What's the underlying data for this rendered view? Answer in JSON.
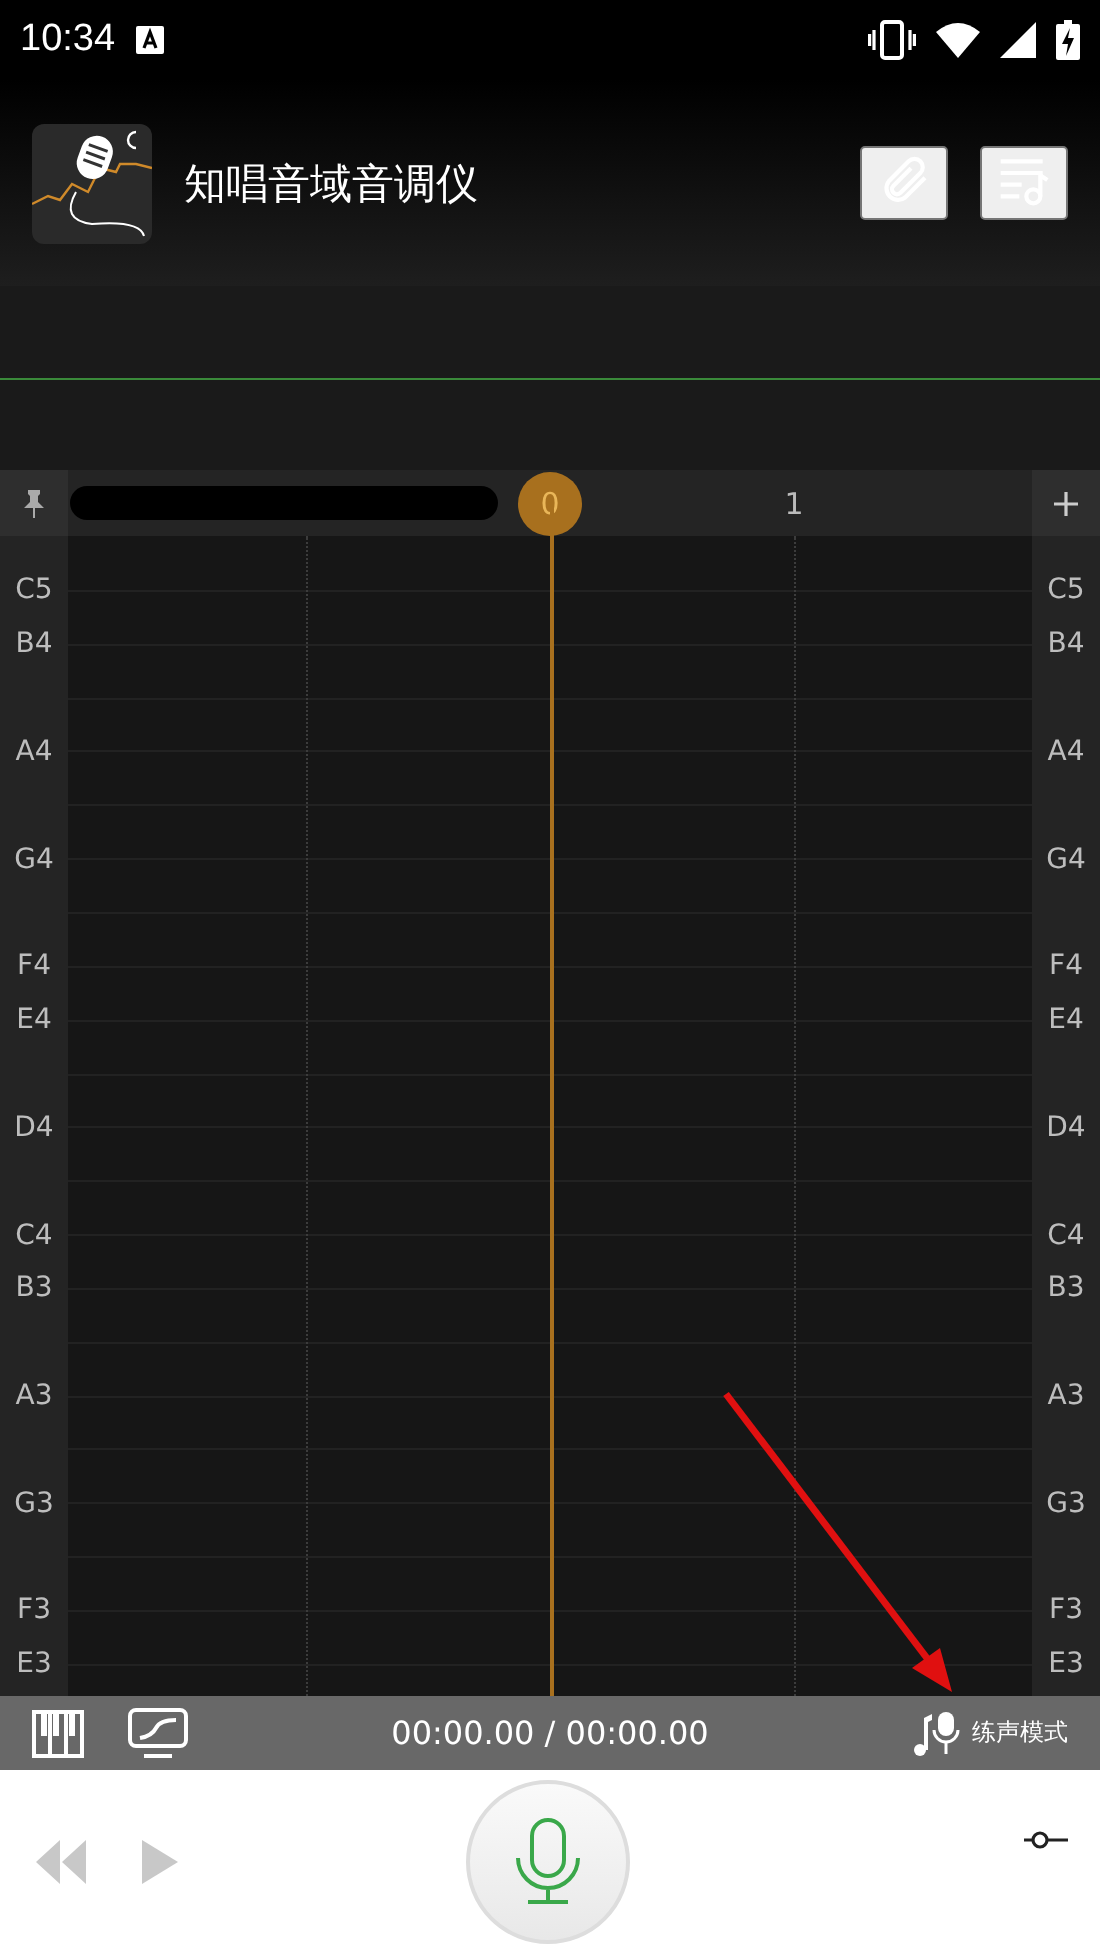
{
  "status_bar": {
    "time": "10:34"
  },
  "app_bar": {
    "title": "知唱音域音调仪"
  },
  "ruler": {
    "ticks": [
      {
        "label": "0",
        "selected": true
      },
      {
        "label": "1",
        "selected": false
      }
    ]
  },
  "pitch_rows": [
    {
      "left": "C5",
      "right": "C5"
    },
    {
      "left": "B4",
      "right": "B4"
    },
    null,
    {
      "left": "A4",
      "right": "A4"
    },
    null,
    {
      "left": "G4",
      "right": "G4"
    },
    null,
    {
      "left": "F4",
      "right": "F4"
    },
    {
      "left": "E4",
      "right": "E4"
    },
    null,
    {
      "left": "D4",
      "right": "D4"
    },
    null,
    {
      "left": "C4",
      "right": "C4"
    },
    {
      "left": "B3",
      "right": "B3"
    },
    null,
    {
      "left": "A3",
      "right": "A3"
    },
    null,
    {
      "left": "G3",
      "right": "G3"
    },
    null,
    {
      "left": "F3",
      "right": "F3"
    },
    {
      "left": "E3",
      "right": "E3"
    }
  ],
  "toolbar": {
    "time": "00:00.00 / 00:00.00",
    "mode": "练声模式"
  },
  "controls": {
    "rewind": {
      "disabled": true
    },
    "play": {
      "disabled": true
    }
  }
}
